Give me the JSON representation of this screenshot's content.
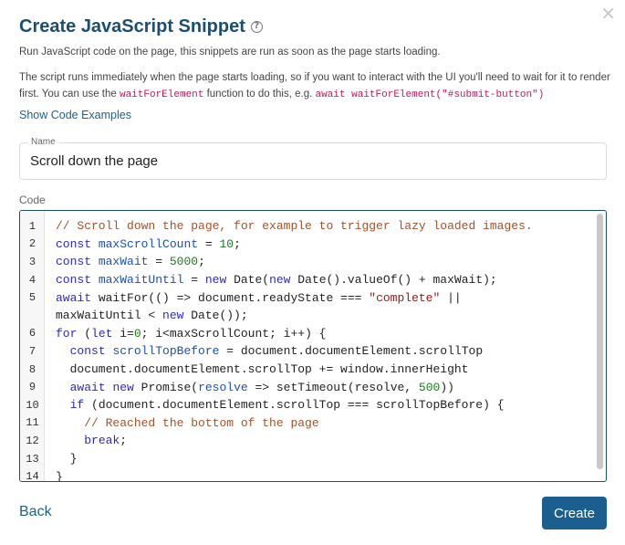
{
  "dialog": {
    "title": "Create JavaScript Snippet",
    "close_glyph": "×",
    "description1": "Run JavaScript code on the page, this snippets are run as soon as the page starts loading.",
    "description2_part1": "The script runs immediately when the page starts loading, so if you want to interact with the UI you'll need to wait for it to render first. You can use the ",
    "description2_fn": "waitForElement",
    "description2_part2": " function to do this, e.g. ",
    "description2_example": "await waitForElement(\"#submit-button\")",
    "show_examples": "Show Code Examples"
  },
  "form": {
    "name_label": "Name",
    "name_value": "Scroll down the page",
    "code_label": "Code"
  },
  "code": {
    "line_numbers": [
      "1",
      "2",
      "3",
      "4",
      "5",
      "",
      "6",
      "7",
      "8",
      "9",
      "10",
      "11",
      "12",
      "13",
      "14"
    ]
  },
  "buttons": {
    "back": "Back",
    "create": "Create"
  },
  "colors": {
    "accent": "#1a5f8f",
    "title": "#1b4f72",
    "link": "#1f5f8b"
  },
  "icons": {
    "help": "help-circle-icon",
    "close": "close-icon"
  }
}
